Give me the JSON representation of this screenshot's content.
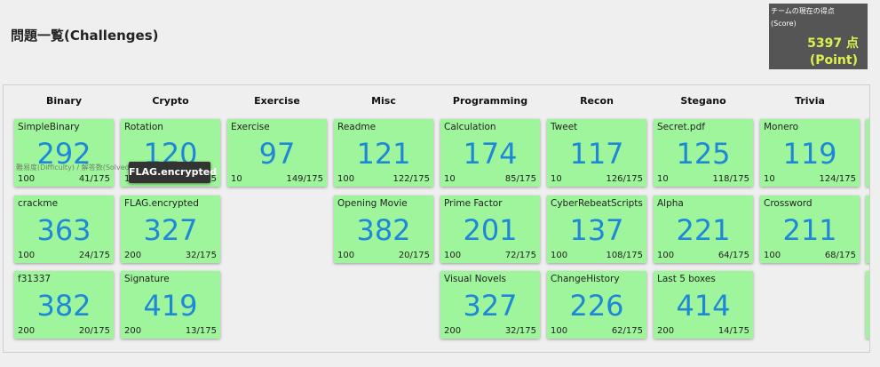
{
  "page": {
    "title": "問題一覧(Challenges)"
  },
  "score": {
    "label": "チームの現在の得点",
    "label_sub": "(Score)",
    "value": "5397 点",
    "point_label": "(Point)"
  },
  "categories": [
    "Binary",
    "Crypto",
    "Exercise",
    "Misc",
    "Programming",
    "Recon",
    "Stegano",
    "Trivia"
  ],
  "challenges": {
    "binary": [
      {
        "name": "SimpleBinary",
        "score": "292",
        "points": "100",
        "solved": "41/175"
      },
      {
        "name": "crackme",
        "score": "363",
        "points": "100",
        "solved": "24/175"
      },
      {
        "name": "f31337",
        "score": "382",
        "points": "200",
        "solved": "20/175"
      }
    ],
    "crypto": [
      {
        "name": "Rotation",
        "score": "120",
        "points": "100",
        "solved": "116/175"
      },
      {
        "name": "FLAG.encrypted",
        "score": "327",
        "points": "200",
        "solved": "32/175"
      },
      {
        "name": "Signature",
        "score": "419",
        "points": "200",
        "solved": "13/175"
      }
    ],
    "exercise": [
      {
        "name": "Exercise",
        "score": "97",
        "points": "10",
        "solved": "149/175"
      }
    ],
    "misc": [
      {
        "name": "Readme",
        "score": "121",
        "points": "100",
        "solved": "122/175"
      },
      {
        "name": "Opening Movie",
        "score": "382",
        "points": "100",
        "solved": "20/175"
      }
    ],
    "programming": [
      {
        "name": "Calculation",
        "score": "174",
        "points": "10",
        "solved": "85/175"
      },
      {
        "name": "Prime Factor",
        "score": "201",
        "points": "100",
        "solved": "72/175"
      },
      {
        "name": "Visual Novels",
        "score": "327",
        "points": "200",
        "solved": "32/175"
      }
    ],
    "recon": [
      {
        "name": "Tweet",
        "score": "117",
        "points": "10",
        "solved": "126/175"
      },
      {
        "name": "CyberRebeatScripts",
        "score": "137",
        "points": "100",
        "solved": "108/175"
      },
      {
        "name": "ChangeHistory",
        "score": "226",
        "points": "100",
        "solved": "62/175"
      }
    ],
    "stegano": [
      {
        "name": "Secret.pdf",
        "score": "125",
        "points": "10",
        "solved": "118/175"
      },
      {
        "name": "Alpha",
        "score": "221",
        "points": "100",
        "solved": "64/175"
      },
      {
        "name": "Last 5 boxes",
        "score": "414",
        "points": "200",
        "solved": "14/175"
      }
    ],
    "trivia": [
      {
        "name": "Monero",
        "score": "119",
        "points": "10",
        "solved": "124/175"
      },
      {
        "name": "Crossword",
        "score": "211",
        "points": "100",
        "solved": "68/175"
      }
    ]
  },
  "hint_overlay": "難易度(Difficulty) / 解答数(Solved)",
  "tooltip": "FLAG.encrypted"
}
